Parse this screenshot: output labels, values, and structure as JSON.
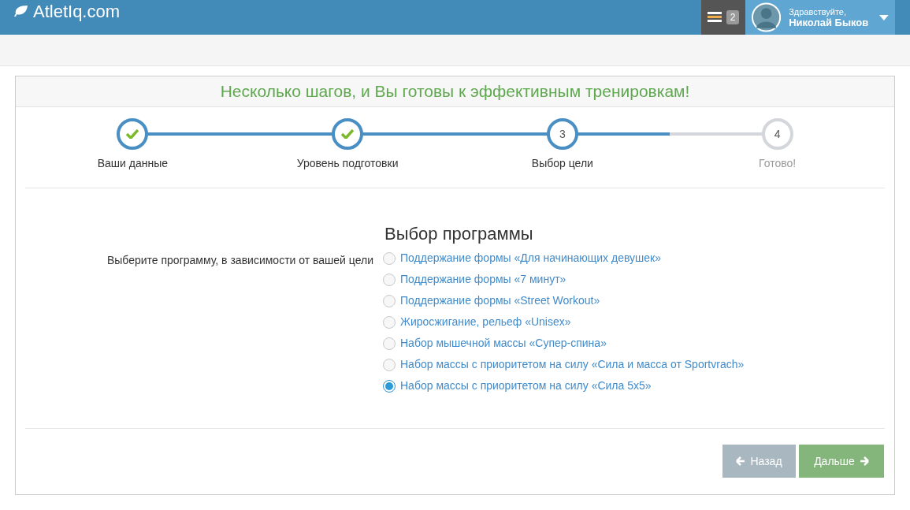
{
  "header": {
    "logo": "AtletIq.com",
    "notifications_count": "2",
    "greeting": "Здравствуйте,",
    "user_name": "Николай Быков"
  },
  "wizard": {
    "title": "Несколько шагов, и Вы готовы к эффективным тренировкам!",
    "steps": [
      {
        "label": "Ваши данные",
        "done": true,
        "current": false
      },
      {
        "label": "Уровень подготовки",
        "done": true,
        "current": false
      },
      {
        "label": "Выбор цели",
        "number": "3",
        "done": false,
        "current": true
      },
      {
        "label": "Готово!",
        "number": "4",
        "done": false,
        "current": false
      }
    ],
    "section_title": "Выбор программы",
    "field_label": "Выберите программу, в зависимости от вашей цели",
    "options": [
      {
        "label": "Поддержание формы «Для начинающих девушек»",
        "selected": false
      },
      {
        "label": "Поддержание формы «7 минут»",
        "selected": false
      },
      {
        "label": "Поддержание формы «Street Workout»",
        "selected": false
      },
      {
        "label": "Жиросжигание, рельеф «Unisex»",
        "selected": false
      },
      {
        "label": "Набор мышечной массы «Супер-спина»",
        "selected": false
      },
      {
        "label": "Набор массы с приоритетом на силу «Сила и масса от Sportvrach»",
        "selected": false
      },
      {
        "label": "Набор массы с приоритетом на силу «Сила 5x5»",
        "selected": true
      }
    ],
    "back_button": "Назад",
    "next_button": "Дальше"
  }
}
